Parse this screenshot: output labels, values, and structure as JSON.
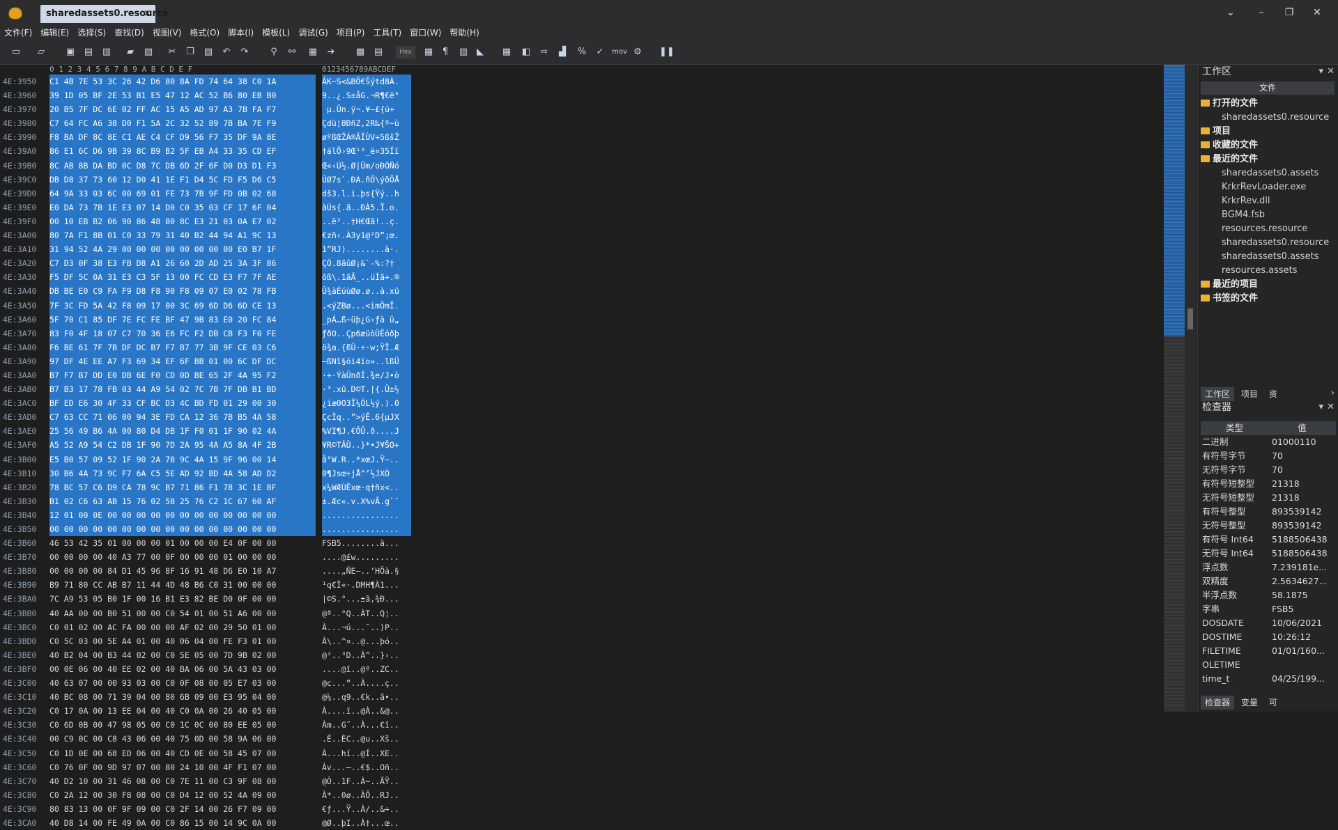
{
  "titlebar": {
    "tab_label": "sharedassets0.resource",
    "tab_close": "×",
    "btn_dropdown": "⌄",
    "btn_min": "–",
    "btn_max": "❐",
    "btn_close": "✕"
  },
  "menu": [
    "文件(F)",
    "编辑(E)",
    "选择(S)",
    "查找(D)",
    "视图(V)",
    "格式(O)",
    "脚本(I)",
    "模板(L)",
    "调试(G)",
    "项目(P)",
    "工具(T)",
    "窗口(W)",
    "帮助(H)"
  ],
  "toolbar": {
    "hex_label": "Hex",
    "mov_label": "mov"
  },
  "editor": {
    "column_header_hex": "0 1 2 3 4 5 6 7 8 9 A B C D E F",
    "column_header_ascii": "0123456789ABCDEF",
    "rows": [
      {
        "addr": "4E:3950",
        "hex": "C1 4B 7E 53 3C 26 42 D6 80 8A FD 74 64 38 C0 1A",
        "ascii": "ÁK~S<&BÖ€Šýtd8À.",
        "sel": true
      },
      {
        "addr": "4E:3960",
        "hex": "39 1D 05 BF 2E 53 B1 E5 47 12 AC 52 B6 80 EB B0",
        "ascii": "9..¿.S±åG.¬R¶€ë°",
        "sel": true
      },
      {
        "addr": "4E:3970",
        "hex": "20 B5 7F DC 6E 02 FF AC 15 A5 AD 97 A3 7B FA F7",
        "ascii": " µ.Ün.ÿ¬.¥­—£{ú÷",
        "sel": true
      },
      {
        "addr": "4E:3980",
        "hex": "C7 64 FC A6 38 D0 F1 5A 2C 32 52 89 7B BA 7E F9",
        "ascii": "Çdü¦8ÐñZ,2R‰{º~ù",
        "sel": true
      },
      {
        "addr": "4E:3990",
        "hex": "F8 BA DF 8C 8E C1 AE C4 CF D9 56 F7 35 DF 9A 8E",
        "ascii": "øºßŒŽÁ®ÄÏÙV÷5ßšŽ",
        "sel": true
      },
      {
        "addr": "4E:39A0",
        "hex": "86 E1 6C D6 9B 39 8C B9 B2 5F EB A4 33 35 CD EF",
        "ascii": "†álÖ›9Œ¹²_ë¤35Íï",
        "sel": true
      },
      {
        "addr": "4E:39B0",
        "hex": "8C AB 8B DA BD 0C D8 7C DB 6D 2F 6F D0 D3 D1 F3",
        "ascii": "Œ«‹Ú½.Ø|Ûm/oÐÓÑó",
        "sel": true
      },
      {
        "addr": "4E:39C0",
        "hex": "DB D8 37 73 60 12 D0 41 1E F1 D4 5C FD F5 D6 C5",
        "ascii": "ÛØ7s`.ÐA.ñÔ\\ýõÖÅ",
        "sel": true
      },
      {
        "addr": "4E:39D0",
        "hex": "64 9A 33 03 6C 00 69 01 FE 73 7B 9F FD 0B 02 68",
        "ascii": "dš3.l.i.þs{Ÿý..h",
        "sel": true
      },
      {
        "addr": "4E:39E0",
        "hex": "E0 DA 73 7B 1E E3 07 14 D0 C0 35 03 CF 17 6F 04",
        "ascii": "àÚs{.ã..ÐÀ5.Ï.o.",
        "sel": true
      },
      {
        "addr": "4E:39F0",
        "hex": "00 10 EB B2 06 90 86 48 80 8C E3 21 03 0A E7 02",
        "ascii": "..ë²..†H€Œã!..ç.",
        "sel": true
      },
      {
        "addr": "4E:3A00",
        "hex": "80 7A F1 8B 01 C0 33 79 31 40 B2 44 94 A1 9C 13",
        "ascii": "€zñ‹.À3y1@²D”¡œ.",
        "sel": true
      },
      {
        "addr": "4E:3A10",
        "hex": "31 94 52 4A 29 00 00 00 00 00 00 00 00 E0 B7 1F",
        "ascii": "1”RJ)........à·.",
        "sel": true
      },
      {
        "addr": "4E:3A20",
        "hex": "C7 D3 0F 38 E3 FB D8 A1 26 60 2D AD 25 3A 3F 86",
        "ascii": "ÇÓ.8ãûØ¡&`-­%:?†",
        "sel": true
      },
      {
        "addr": "4E:3A30",
        "hex": "F5 DF 5C 0A 31 E3 C3 5F 13 00 FC CD E3 F7 7F AE",
        "ascii": "õß\\.1ãÃ_..üÍã÷.®",
        "sel": true
      },
      {
        "addr": "4E:3A40",
        "hex": "DB BE E0 C9 FA F9 D8 F8 90 F8 09 07 E0 02 78 FB",
        "ascii": "Û¾àÉúùØø.ø..à.xû",
        "sel": true
      },
      {
        "addr": "4E:3A50",
        "hex": "7F 3C FD 5A 42 F8 09 17 00 3C 69 6D D6 6D CE 13",
        "ascii": ".<ýZBø...<imÖmÎ.",
        "sel": true
      },
      {
        "addr": "4E:3A60",
        "hex": "5F 70 C1 85 DF 7E FC FE BF 47 9B 83 E0 20 FC 84",
        "ascii": "_pÁ…ß~üþ¿G›ƒà ü„",
        "sel": true
      },
      {
        "addr": "4E:3A70",
        "hex": "83 F0 4F 18 07 C7 70 36 E6 FC F2 DB CB F3 F0 FE",
        "ascii": "ƒðO..Çp6æüòÛËóðþ",
        "sel": true
      },
      {
        "addr": "4E:3A80",
        "hex": "F6 BE 61 7F 7B DF DC B7 F7 B7 77 3B 9F CE 03 C6",
        "ascii": "ö¾a.{ßÜ·÷·w;ŸÎ.Æ",
        "sel": true
      },
      {
        "addr": "4E:3A90",
        "hex": "97 DF 4E EE A7 F3 69 34 EF 6F BB 01 00 6C DF DC",
        "ascii": "—ßNî§ói4ïo»..lßÜ",
        "sel": true
      },
      {
        "addr": "4E:3AA0",
        "hex": "B7 F7 B7 DD E0 DB 6E F0 CD 0D BE 65 2F 4A 95 F2",
        "ascii": "·÷·ÝàÛnðÍ.¾e/J•ò",
        "sel": true
      },
      {
        "addr": "4E:3AB0",
        "hex": "B7 B3 17 78 FB 03 44 A9 54 02 7C 7B 7F DB B1 BD",
        "ascii": "·³.xû.D©T.|{.Û±½",
        "sel": true
      },
      {
        "addr": "4E:3AC0",
        "hex": "BF ED E6 30 4F 33 CF BC D3 4C BD FD 01 29 00 30",
        "ascii": "¿íæ0O3Ï¼ÓL½ý.).0",
        "sel": true
      },
      {
        "addr": "4E:3AD0",
        "hex": "C7 63 CC 71 06 00 94 3E FD CA 12 36 7B B5 4A 58",
        "ascii": "ÇcÌq..”>ýÊ.6{µJX",
        "sel": true
      },
      {
        "addr": "4E:3AE0",
        "hex": "25 56 49 B6 4A 00 80 D4 DB 1F F0 01 1F 90 02 4A",
        "ascii": "%VI¶J.€ÔÛ.ð....J",
        "sel": true
      },
      {
        "addr": "4E:3AF0",
        "hex": "A5 52 A9 54 C2 DB 1F 90 7D 2A 95 4A A5 8A 4F 2B",
        "ascii": "¥R©TÂÛ..}*•J¥ŠO+",
        "sel": true
      },
      {
        "addr": "4E:3B00",
        "hex": "E5 B0 57 09 52 1F 90 2A 78 9C 4A 15 9F 96 00 14",
        "ascii": "å°W.R..*xœJ.Ÿ–..",
        "sel": true
      },
      {
        "addr": "4E:3B10",
        "hex": "30 B6 4A 73 9C F7 6A C5 5E AD 92 BD 4A 58 AD D2",
        "ascii": "0¶Jsœ÷jÅ^­’½JX­Ò",
        "sel": true
      },
      {
        "addr": "4E:3B20",
        "hex": "78 BC 57 C6 D9 CA 78 9C B7 71 86 F1 78 3C 1E 8F",
        "ascii": "x¼WÆÙÊxœ·q†ñx<..",
        "sel": true
      },
      {
        "addr": "4E:3B30",
        "hex": "B1 02 C6 63 AB 15 76 02 58 25 76 C2 1C 67 60 AF",
        "ascii": "±.Æc«.v.X%vÂ.g`¯",
        "sel": true
      },
      {
        "addr": "4E:3B40",
        "hex": "12 01 00 0E 00 00 00 00 00 00 00 00 00 00 00 00",
        "ascii": "................",
        "sel": true
      },
      {
        "addr": "4E:3B50",
        "hex": "00 00 00 00 00 00 00 00 00 00 00 00 00 00 00 00",
        "ascii": "................",
        "sel": true
      },
      {
        "addr": "4E:3B60",
        "hex": "46 53 42 35 01 00 00 00 01 00 00 00 E4 0F 00 00",
        "ascii": "FSB5........ä...",
        "sel": false
      },
      {
        "addr": "4E:3B70",
        "hex": "00 00 00 00 40 A3 77 00 0F 00 00 00 01 00 00 00",
        "ascii": "....@£w.........",
        "sel": false
      },
      {
        "addr": "4E:3B80",
        "hex": "00 00 00 00 84 D1 45 96 8F 16 91 48 D6 E0 10 A7",
        "ascii": "....„ÑE–..‘HÖà.§",
        "sel": false
      },
      {
        "addr": "4E:3B90",
        "hex": "B9 71 80 CC AB B7 11 44 4D 48 B6 C0 31 00 00 00",
        "ascii": "¹q€Ì«·.DMH¶À1...",
        "sel": false
      },
      {
        "addr": "4E:3BA0",
        "hex": "7C A9 53 05 B0 1F 00 16 B1 E3 82 BE D0 0F 00 00",
        "ascii": "|©S.°...±ã‚¾Ð...",
        "sel": false
      },
      {
        "addr": "4E:3BB0",
        "hex": "40 AA 00 00 B0 51 00 00 C0 54 01 00 51 A6 00 00",
        "ascii": "@ª..°Q..ÀT..Q¦..",
        "sel": false
      },
      {
        "addr": "4E:3BC0",
        "hex": "C0 01 02 00 AC FA 00 00 00 AF 02 00 29 50 01 00",
        "ascii": "À...¬ú...¯..)P..",
        "sel": false
      },
      {
        "addr": "4E:3BD0",
        "hex": "C0 5C 03 00 5E A4 01 00 40 06 04 00 FE F3 01 00",
        "ascii": "À\\..^¤..@...þó..",
        "sel": false
      },
      {
        "addr": "4E:3BE0",
        "hex": "40 B2 04 00 B3 44 02 00 C0 5E 05 00 7D 9B 02 00",
        "ascii": "@²..³D..À^..}›..",
        "sel": false
      },
      {
        "addr": "4E:3BF0",
        "hex": "00 0E 06 00 40 EE 02 00 40 BA 06 00 5A 43 03 00",
        "ascii": "....@î..@º..ZC..",
        "sel": false
      },
      {
        "addr": "4E:3C00",
        "hex": "40 63 07 00 00 93 03 00 C0 0F 08 00 05 E7 03 00",
        "ascii": "@c...“..À....ç..",
        "sel": false
      },
      {
        "addr": "4E:3C10",
        "hex": "40 BC 08 00 71 39 04 00 80 6B 09 00 E3 95 04 00",
        "ascii": "@¼..q9..€k..ã•..",
        "sel": false
      },
      {
        "addr": "4E:3C20",
        "hex": "C0 17 0A 00 13 EE 04 00 40 C0 0A 00 26 40 05 00",
        "ascii": "À....î..@À..&@..",
        "sel": false
      },
      {
        "addr": "4E:3C30",
        "hex": "C0 6D 0B 00 47 98 05 00 C0 1C 0C 00 80 EE 05 00",
        "ascii": "Àm..G˜..À...€î..",
        "sel": false
      },
      {
        "addr": "4E:3C40",
        "hex": "00 C9 0C 00 C8 43 06 00 40 75 0D 00 58 9A 06 00",
        "ascii": ".É..ÈC..@u..Xš..",
        "sel": false
      },
      {
        "addr": "4E:3C50",
        "hex": "C0 1D 0E 00 68 ED 06 00 40 CD 0E 00 58 45 07 00",
        "ascii": "À...hí..@Í..XE..",
        "sel": false
      },
      {
        "addr": "4E:3C60",
        "hex": "C0 76 0F 00 9D 97 07 00 80 24 10 00 4F F1 07 00",
        "ascii": "Àv...—..€$..Oñ..",
        "sel": false
      },
      {
        "addr": "4E:3C70",
        "hex": "40 D2 10 00 31 46 08 00 C0 7E 11 00 C3 9F 08 00",
        "ascii": "@Ò..1F..À~..ÃŸ..",
        "sel": false
      },
      {
        "addr": "4E:3C80",
        "hex": "C0 2A 12 00 30 F8 08 00 C0 D4 12 00 52 4A 09 00",
        "ascii": "À*..0ø..ÀÔ..RJ..",
        "sel": false
      },
      {
        "addr": "4E:3C90",
        "hex": "80 83 13 00 0F 9F 09 00 C0 2F 14 00 26 F7 09 00",
        "ascii": "€ƒ...Ÿ..À/..&÷..",
        "sel": false
      },
      {
        "addr": "4E:3CA0",
        "hex": "40 D8 14 00 FE 49 0A 00 C0 86 15 00 14 9C 0A 00",
        "ascii": "@Ø..þI..À†...œ..",
        "sel": false
      }
    ]
  },
  "workspace": {
    "title": "工作区",
    "subheader": "文件",
    "open_files": "打开的文件",
    "open_files_children": [
      "sharedassets0.resource"
    ],
    "projects": "项目",
    "favorites": "收藏的文件",
    "recent_files": "最近的文件",
    "recent_children": [
      "sharedassets0.assets",
      "KrkrRevLoader.exe",
      "KrkrRev.dll",
      "BGM4.fsb",
      "resources.resource",
      "sharedassets0.resource",
      "sharedassets0.assets",
      "resources.assets"
    ],
    "recent_projects": "最近的项目",
    "bookmarked": "书签的文件",
    "tabs": [
      "工作区",
      "项目",
      "资"
    ]
  },
  "inspector": {
    "title": "检查器",
    "col_type": "类型",
    "col_value": "值",
    "rows": [
      {
        "k": "二进制",
        "v": "01000110"
      },
      {
        "k": "有符号字节",
        "v": "70"
      },
      {
        "k": "无符号字节",
        "v": "70"
      },
      {
        "k": "有符号短整型",
        "v": "21318"
      },
      {
        "k": "无符号短整型",
        "v": "21318"
      },
      {
        "k": "有符号整型",
        "v": "893539142"
      },
      {
        "k": "无符号整型",
        "v": "893539142"
      },
      {
        "k": "有符号 Int64",
        "v": "5188506438"
      },
      {
        "k": "无符号 Int64",
        "v": "5188506438"
      },
      {
        "k": "浮点数",
        "v": "7.239181e..."
      },
      {
        "k": "双精度",
        "v": "2.5634627..."
      },
      {
        "k": "半浮点数",
        "v": "58.1875"
      },
      {
        "k": "字串",
        "v": "FSB5"
      },
      {
        "k": "DOSDATE",
        "v": "10/06/2021"
      },
      {
        "k": "DOSTIME",
        "v": "10:26:12"
      },
      {
        "k": "FILETIME",
        "v": "01/01/160..."
      },
      {
        "k": "OLETIME",
        "v": ""
      },
      {
        "k": "time_t",
        "v": "04/25/199..."
      }
    ],
    "tabs": [
      "检查器",
      "变量",
      "可"
    ]
  }
}
